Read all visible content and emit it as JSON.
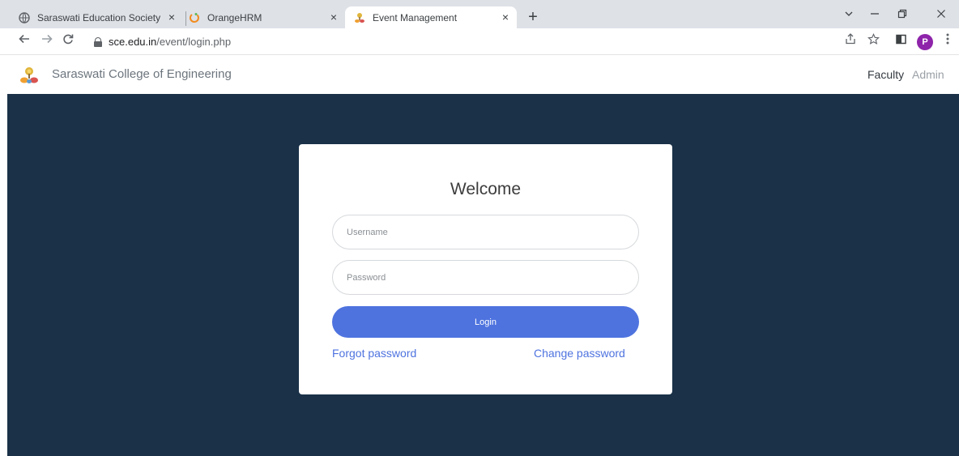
{
  "browser": {
    "tabs": [
      {
        "title": "Saraswati Education Society",
        "favicon": "globe-icon",
        "active": false
      },
      {
        "title": "OrangeHRM",
        "favicon": "orangehrm-icon",
        "active": false
      },
      {
        "title": "Event Management",
        "favicon": "college-logo-icon",
        "active": true
      }
    ],
    "tab_close": "×",
    "new_tab": "+",
    "url_host": "sce.edu.in",
    "url_path": "/event/login.php",
    "profile_initial": "P",
    "profile_color": "#8e24aa"
  },
  "site": {
    "brand": "Saraswati College of Engineering",
    "nav": {
      "faculty": "Faculty",
      "admin": "Admin"
    }
  },
  "login": {
    "title": "Welcome",
    "username_placeholder": "Username",
    "password_placeholder": "Password",
    "login_label": "Login",
    "forgot_label": "Forgot password",
    "change_label": "Change password"
  },
  "colors": {
    "background": "#1a3148",
    "accent": "#4e73df"
  }
}
